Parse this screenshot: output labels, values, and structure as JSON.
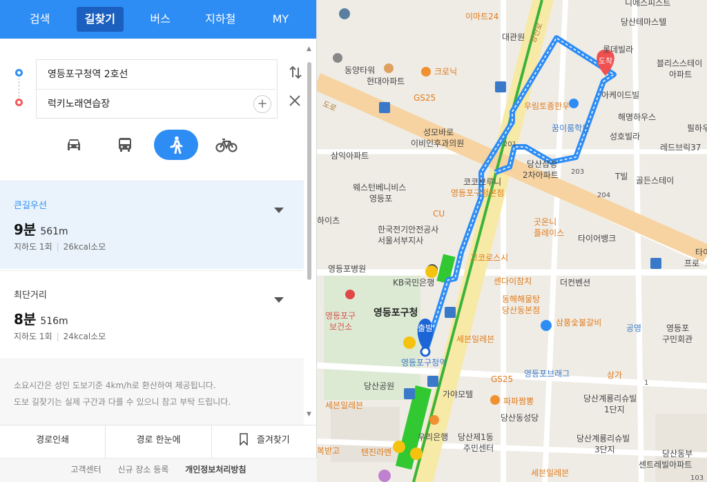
{
  "nav": {
    "tabs": [
      "검색",
      "길찾기",
      "버스",
      "지하철",
      "MY"
    ],
    "active": "길찾기"
  },
  "search": {
    "origin": "영등포구청역 2호선",
    "destination": "럭키노래연습장"
  },
  "modes": [
    "car-icon",
    "bus-icon",
    "walk-icon",
    "bike-icon"
  ],
  "routes": [
    {
      "title": "큰길우선",
      "time": "9분",
      "distance": "561m",
      "detail_a": "지하도 1회",
      "detail_b": "26kcal소모"
    },
    {
      "title": "최단거리",
      "time": "8분",
      "distance": "516m",
      "detail_a": "지하도 1회",
      "detail_b": "24kcal소모"
    }
  ],
  "notice": {
    "line1": "소요시간은 성인 도보기준 4km/h로 환산하여 제공됩니다.",
    "line2": "도보 길찾기는 실제 구간과 다를 수 있으니 참고 부탁 드립니다."
  },
  "actions": {
    "print": "경로인쇄",
    "overview": "경로 한눈에",
    "favorite": "즐겨찾기"
  },
  "footer": {
    "customer": "고객센터",
    "register": "신규 장소 등록",
    "privacy": "개인정보처리방침"
  },
  "map": {
    "start_label": "출발",
    "end_label": "도착",
    "labels": {
      "l_emart": "이마트24",
      "l_daegwan": "대관원",
      "l_yangsan": "양산로",
      "l_lotteria": "롯데빌라",
      "l_dangsan_tower": "당산테마스텔",
      "l_bliss": "블리스스테이",
      "l_apt": "아파트",
      "l_dongyang": "동양타워",
      "l_hyundai": "현대아파트",
      "l_croque": "크로닉",
      "l_gs25a": "GS25",
      "l_hanwoo": "우림토종한우",
      "l_arcade": "아케이드빌",
      "l_haemyung": "해명하우스",
      "l_pil": "필하우",
      "l_dream": "꿈이룸학원",
      "l_seongho": "성호빌라",
      "l_redbrick": "레드브릭37",
      "l_seongmo": "성모바로",
      "l_clinic": "이비인후과의원",
      "l_samik": "삼익아파트",
      "l_dangsan_samsung": "당산삼성",
      "l_2cha": "2차아파트",
      "l_tbil": "T빌",
      "l_golden": "골든스테이",
      "l_western": "웨스턴베니비스",
      "l_ydp": "영등포",
      "l_coco": "코코브루니",
      "l_ydpgu": "영등포구청본점",
      "l_cu": "CU",
      "l_hais": "하이츠",
      "l_kepco": "한국전기안전공사",
      "l_seoul": "서울서부지사",
      "l_gosinni": "곳온니",
      "l_play": "플레이스",
      "l_tyo": "타이어뱅크",
      "l_hospital": "영등포병원",
      "l_kb": "KB국민은행",
      "l_cocorosi": "고코로스시",
      "l_center": "센다이참치",
      "l_donghae": "동해해물탕",
      "l_dangsan_main": "당산동본점",
      "l_convention": "더컨벤션",
      "l_health": "영등포구",
      "l_health2": "보건소",
      "l_ydpgucheong": "영등포구청",
      "l_samsung_chicken": "삼풍숯불갈비",
      "l_gongyoung": "공영",
      "l_ydp2": "영등포",
      "l_gumin": "구민회관",
      "l_sebeun": "세븐일레븐",
      "l_station": "영등포구청역",
      "l_briage": "영등포브래그",
      "l_sanga": "상가",
      "l_gs25b": "GS25",
      "l_park": "당산공원",
      "l_sebeun2": "세븐일레븐",
      "l_gaya": "가야모텔",
      "l_papa": "파파짬뽕",
      "l_dangsan_suite": "당산계룡리슈빌",
      "l_1danji": "1단지",
      "l_dangsan_church": "당산동성당",
      "l_woori": "우리은행",
      "l_jumin": "당산제1동",
      "l_jumin2": "주민센터",
      "l_dangsan_suite3": "당산계룡리슈빌",
      "l_3danji": "3단지",
      "l_dangsan_east": "당산동부",
      "l_centrebil": "센트레빌아파트",
      "l_bokbad": "복받고",
      "l_tenjin": "텐진라멘",
      "l_sebeun3": "세븐일레븐",
      "l_diamond": "디에스피스트",
      "l_dohyun": "도로",
      "l_pro": "프로",
      "l_tai": "타이",
      "r_201": "201",
      "r_203": "203",
      "r_204": "204",
      "r_1": "1",
      "r_103": "103"
    },
    "colors": {
      "route": "#2e8df5",
      "line2": "#3bb33b",
      "road_yellow": "#f7e9a6",
      "road_orange": "#f6d3a0"
    }
  }
}
